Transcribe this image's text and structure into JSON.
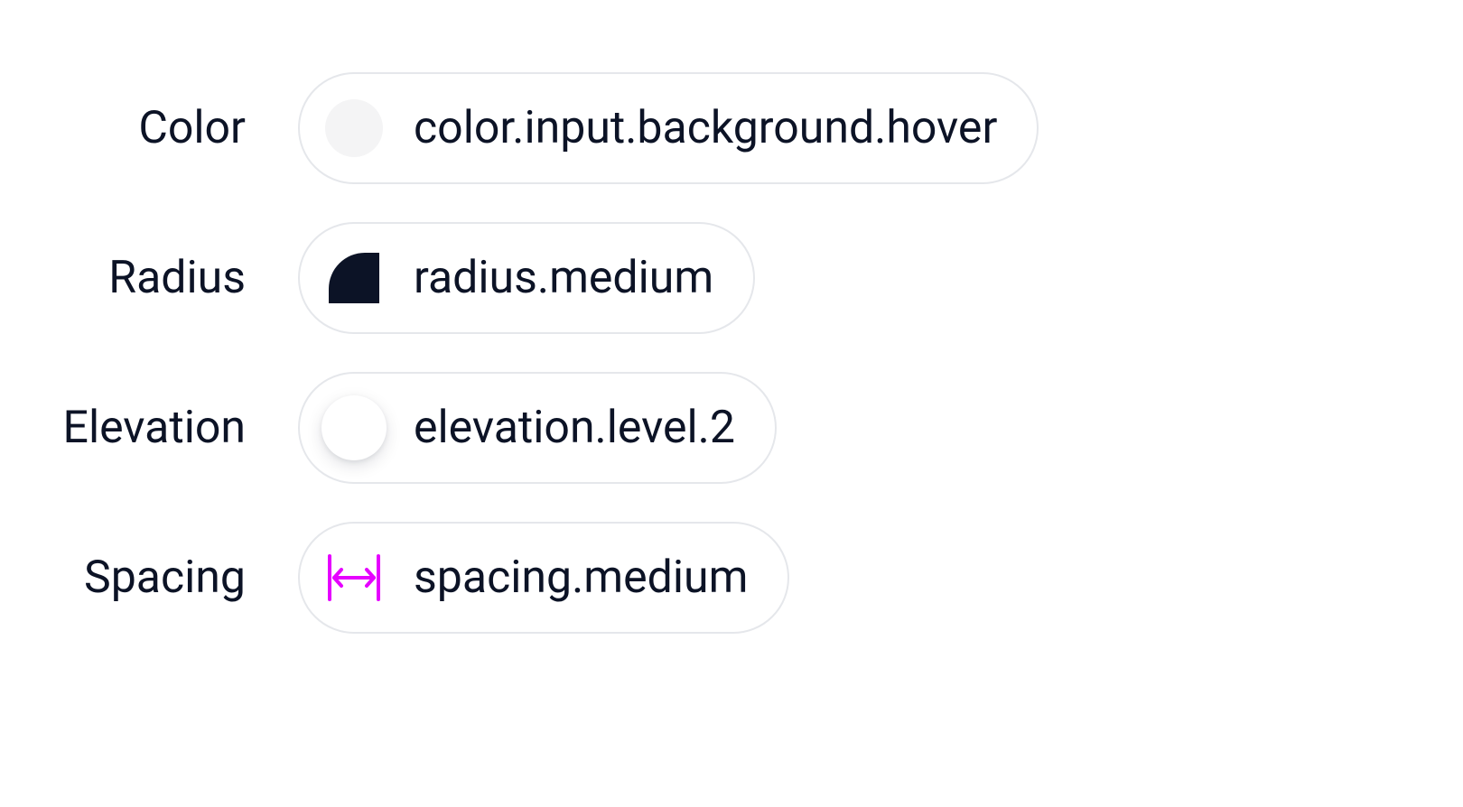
{
  "tokens": {
    "color": {
      "label": "Color",
      "name": "color.input.background.hover",
      "swatch_color": "#f4f4f5"
    },
    "radius": {
      "label": "Radius",
      "name": "radius.medium"
    },
    "elevation": {
      "label": "Elevation",
      "name": "elevation.level.2"
    },
    "spacing": {
      "label": "Spacing",
      "name": "spacing.medium",
      "accent": "#e600ff"
    }
  }
}
